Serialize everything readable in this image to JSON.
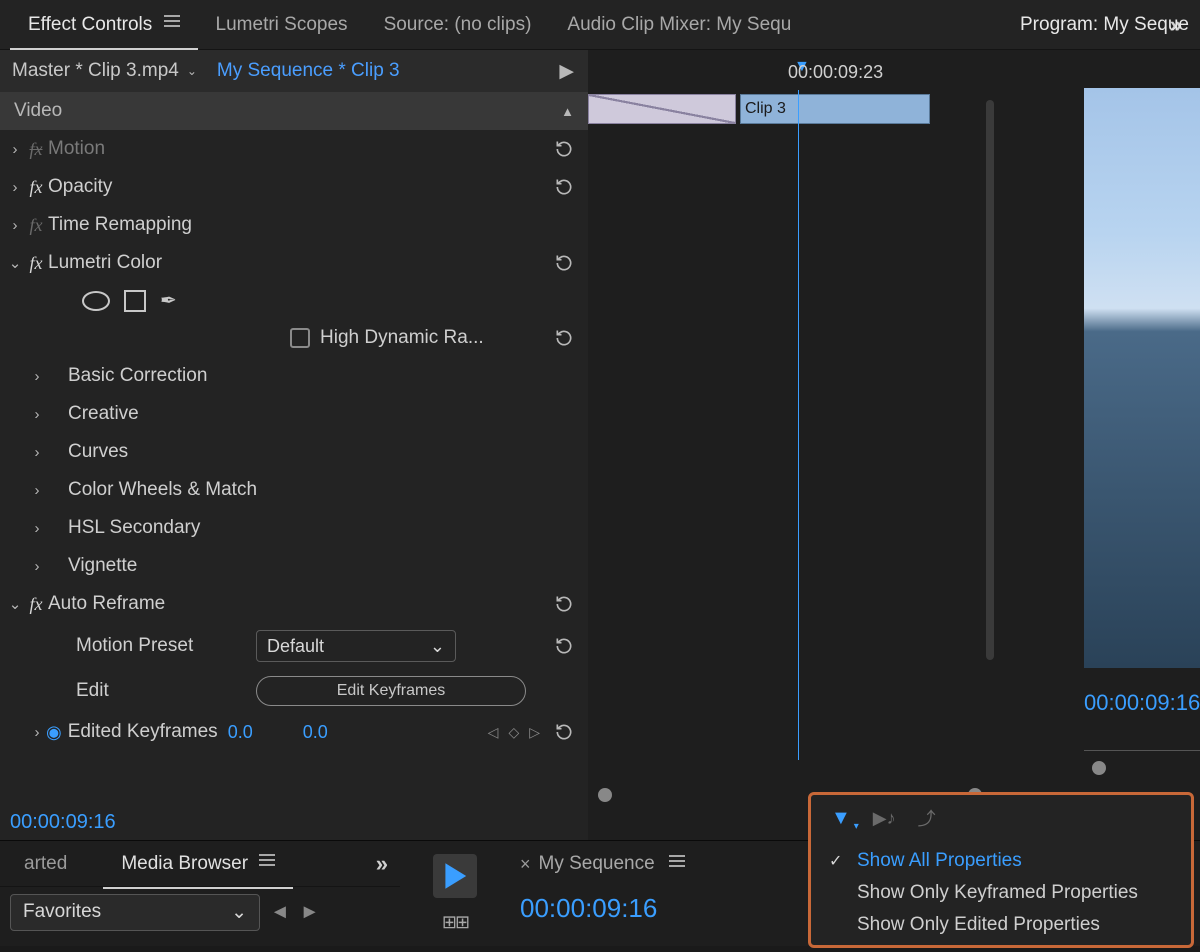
{
  "tabs": {
    "effect_controls": "Effect Controls",
    "lumetri_scopes": "Lumetri Scopes",
    "source": "Source: (no clips)",
    "audio_mixer": "Audio Clip Mixer: My Sequ",
    "program": "Program: My Seque"
  },
  "effects": {
    "master_label": "Master * Clip 3.mp4",
    "sequence_label": "My Sequence * Clip 3",
    "section_video": "Video",
    "motion": "Motion",
    "opacity": "Opacity",
    "time_remapping": "Time Remapping",
    "lumetri_color": "Lumetri Color",
    "hdr_checkbox": "High Dynamic Ra...",
    "lumetri_items": {
      "basic": "Basic Correction",
      "creative": "Creative",
      "curves": "Curves",
      "wheels": "Color Wheels & Match",
      "hsl": "HSL Secondary",
      "vignette": "Vignette"
    },
    "auto_reframe": "Auto Reframe",
    "motion_preset_label": "Motion Preset",
    "motion_preset_value": "Default",
    "edit_label": "Edit",
    "edit_keyframes_btn": "Edit Keyframes",
    "edited_keyframes": "Edited Keyframes",
    "kf_val1": "0.0",
    "kf_val2": "0.0"
  },
  "timeline": {
    "top_timecode": "00:00:09:23",
    "clip2_label": "Clip 3"
  },
  "program_monitor": {
    "timecode": "00:00:09:16"
  },
  "bottom_timecode": "00:00:09:16",
  "lower": {
    "tab_left_cut": "arted",
    "media_browser": "Media Browser",
    "favorites": "Favorites",
    "sequence_tab": "My Sequence",
    "sequence_timecode": "00:00:09:16"
  },
  "filter_menu": {
    "show_all": "Show All Properties",
    "show_keyframed": "Show Only Keyframed Properties",
    "show_edited": "Show Only Edited Properties"
  }
}
